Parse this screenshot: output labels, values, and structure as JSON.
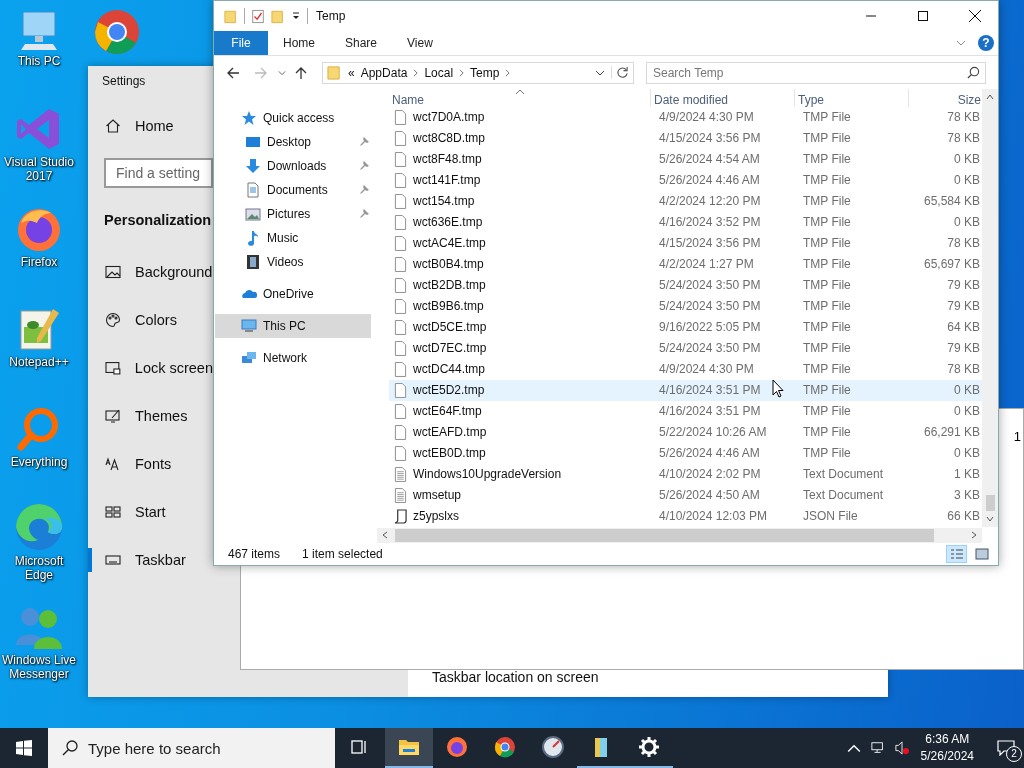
{
  "desktop_icons": [
    {
      "kind": "pc",
      "label": "This PC"
    },
    {
      "kind": "chrome"
    },
    {
      "kind": "vs",
      "label": "Visual Studio 2017"
    },
    {
      "kind": "firefox",
      "label": "Firefox"
    },
    {
      "kind": "notepad",
      "label": "Notepad++"
    },
    {
      "kind": "everything",
      "label": "Everything"
    },
    {
      "kind": "edge",
      "label": "Microsoft Edge"
    },
    {
      "kind": "messenger",
      "label": "Windows Live Messenger"
    }
  ],
  "settings": {
    "title": "Settings",
    "home": "Home",
    "search": {
      "placeholder": "Find a setting"
    },
    "section": "Personalization",
    "items": [
      {
        "kind": "background",
        "label": "Background",
        "selected": false
      },
      {
        "kind": "colors",
        "label": "Colors",
        "selected": false
      },
      {
        "kind": "lock",
        "label": "Lock screen",
        "selected": false
      },
      {
        "kind": "themes",
        "label": "Themes",
        "selected": false
      },
      {
        "kind": "fonts",
        "label": "Fonts",
        "selected": false
      },
      {
        "kind": "start",
        "label": "Start",
        "selected": false
      },
      {
        "kind": "taskbar",
        "label": "Taskbar",
        "selected": true
      }
    ],
    "content_label": "Taskbar location on screen"
  },
  "background_window": {
    "text": "1"
  },
  "explorer": {
    "title": "Temp",
    "help": "?",
    "ribbon_tabs": [
      {
        "kind": "file",
        "label": "File"
      },
      {
        "kind": "tab",
        "label": "Home"
      },
      {
        "kind": "tab",
        "label": "Share"
      },
      {
        "kind": "tab",
        "label": "View"
      }
    ],
    "address": {
      "overflow": "«",
      "crumbs": [
        "AppData",
        "Local",
        "Temp"
      ]
    },
    "search": {
      "placeholder": "Search Temp"
    },
    "nav": [
      {
        "kind": "star",
        "label": "Quick access",
        "selected": false,
        "children": [
          {
            "kind": "desktop",
            "label": "Desktop",
            "pinned": true,
            "selected": false
          },
          {
            "kind": "download",
            "label": "Downloads",
            "pinned": true,
            "selected": false
          },
          {
            "kind": "document",
            "label": "Documents",
            "pinned": true,
            "selected": false
          },
          {
            "kind": "pictures",
            "label": "Pictures",
            "pinned": true,
            "selected": false
          },
          {
            "kind": "music",
            "label": "Music",
            "pinned": false,
            "selected": false
          },
          {
            "kind": "videos",
            "label": "Videos",
            "pinned": false,
            "selected": false
          }
        ]
      },
      {
        "kind": "cloud",
        "label": "OneDrive",
        "selected": false
      },
      {
        "kind": "pc",
        "label": "This PC",
        "selected": true
      },
      {
        "kind": "network",
        "label": "Network",
        "selected": false
      }
    ],
    "columns": [
      {
        "label": "Name",
        "sorted": true
      },
      {
        "label": "Date modified",
        "sorted": false
      },
      {
        "label": "Type",
        "sorted": false
      },
      {
        "label": "Size",
        "sorted": false
      }
    ],
    "rows": [
      {
        "kind": "tmp",
        "name": "wct7D0A.tmp",
        "date": "4/9/2024 4:30 PM",
        "type": "TMP File",
        "size": "78 KB",
        "selected": false
      },
      {
        "kind": "tmp",
        "name": "wct8C8D.tmp",
        "date": "4/15/2024 3:56 PM",
        "type": "TMP File",
        "size": "78 KB",
        "selected": false
      },
      {
        "kind": "tmp",
        "name": "wct8F48.tmp",
        "date": "5/26/2024 4:54 AM",
        "type": "TMP File",
        "size": "0 KB",
        "selected": false
      },
      {
        "kind": "tmp",
        "name": "wct141F.tmp",
        "date": "5/26/2024 4:46 AM",
        "type": "TMP File",
        "size": "0 KB",
        "selected": false
      },
      {
        "kind": "tmp",
        "name": "wct154.tmp",
        "date": "4/2/2024 12:20 PM",
        "type": "TMP File",
        "size": "65,584 KB",
        "selected": false
      },
      {
        "kind": "tmp",
        "name": "wct636E.tmp",
        "date": "4/16/2024 3:52 PM",
        "type": "TMP File",
        "size": "0 KB",
        "selected": false
      },
      {
        "kind": "tmp",
        "name": "wctAC4E.tmp",
        "date": "4/15/2024 3:56 PM",
        "type": "TMP File",
        "size": "78 KB",
        "selected": false
      },
      {
        "kind": "tmp",
        "name": "wctB0B4.tmp",
        "date": "4/2/2024 1:27 PM",
        "type": "TMP File",
        "size": "65,697 KB",
        "selected": false
      },
      {
        "kind": "tmp",
        "name": "wctB2DB.tmp",
        "date": "5/24/2024 3:50 PM",
        "type": "TMP File",
        "size": "79 KB",
        "selected": false
      },
      {
        "kind": "tmp",
        "name": "wctB9B6.tmp",
        "date": "5/24/2024 3:50 PM",
        "type": "TMP File",
        "size": "79 KB",
        "selected": false
      },
      {
        "kind": "tmp",
        "name": "wctD5CE.tmp",
        "date": "9/16/2022 5:05 PM",
        "type": "TMP File",
        "size": "64 KB",
        "selected": false
      },
      {
        "kind": "tmp",
        "name": "wctD7EC.tmp",
        "date": "5/24/2024 3:50 PM",
        "type": "TMP File",
        "size": "79 KB",
        "selected": false
      },
      {
        "kind": "tmp",
        "name": "wctDC44.tmp",
        "date": "4/9/2024 4:30 PM",
        "type": "TMP File",
        "size": "78 KB",
        "selected": false
      },
      {
        "kind": "tmp",
        "name": "wctE5D2.tmp",
        "date": "4/16/2024 3:51 PM",
        "type": "TMP File",
        "size": "0 KB",
        "selected": true
      },
      {
        "kind": "tmp",
        "name": "wctE64F.tmp",
        "date": "4/16/2024 3:51 PM",
        "type": "TMP File",
        "size": "0 KB",
        "selected": false
      },
      {
        "kind": "tmp",
        "name": "wctEAFD.tmp",
        "date": "5/22/2024 10:26 AM",
        "type": "TMP File",
        "size": "66,291 KB",
        "selected": false
      },
      {
        "kind": "tmp",
        "name": "wctEB0D.tmp",
        "date": "5/26/2024 4:46 AM",
        "type": "TMP File",
        "size": "0 KB",
        "selected": false
      },
      {
        "kind": "text",
        "name": "Windows10UpgradeVersion",
        "date": "4/10/2024 2:02 PM",
        "type": "Text Document",
        "size": "1 KB",
        "selected": false
      },
      {
        "kind": "text",
        "name": "wmsetup",
        "date": "5/26/2024 4:50 AM",
        "type": "Text Document",
        "size": "3 KB",
        "selected": false
      },
      {
        "kind": "json",
        "name": "z5ypslxs",
        "date": "4/10/2024 12:03 PM",
        "type": "JSON File",
        "size": "66 KB",
        "selected": false
      }
    ],
    "status": {
      "count": "467 items",
      "selection": "1 item selected"
    },
    "views": [
      {
        "kind": "details",
        "selected": true
      },
      {
        "kind": "large",
        "selected": false
      }
    ]
  },
  "taskbar": {
    "search_placeholder": "Type here to search",
    "apps": [
      {
        "kind": "explorer",
        "active": true,
        "running": true
      },
      {
        "kind": "firefox",
        "active": false,
        "running": false
      },
      {
        "kind": "chrome",
        "active": false,
        "running": false
      },
      {
        "kind": "gauge",
        "active": false,
        "running": false
      },
      {
        "kind": "archive",
        "active": false,
        "running": true
      },
      {
        "kind": "settings",
        "active": false,
        "running": true
      }
    ],
    "time": "6:36 AM",
    "date": "5/26/2024",
    "notification_count": "2"
  }
}
